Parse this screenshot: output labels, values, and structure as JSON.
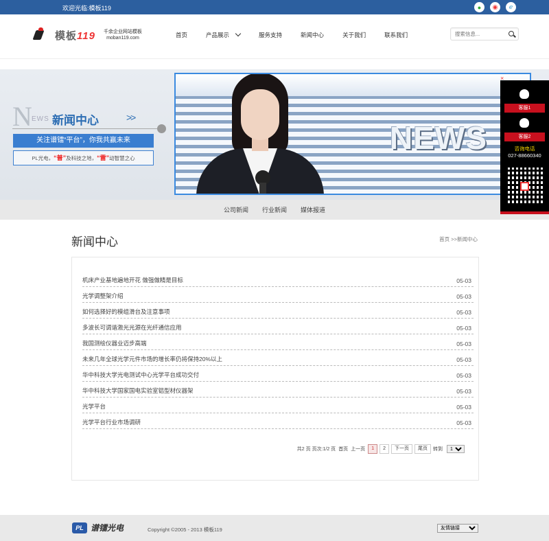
{
  "topbar": {
    "welcome": "欢迎光临:模板119"
  },
  "header": {
    "brand_cn": "模板",
    "brand_num": "119",
    "tagline_line1": "千余企业网站模板",
    "tagline_line2": "moban119.com",
    "nav": [
      {
        "label": "首页"
      },
      {
        "label": "产品展示"
      },
      {
        "label": "服务支持"
      },
      {
        "label": "新闻中心"
      },
      {
        "label": "关于我们"
      },
      {
        "label": "联系我们"
      }
    ],
    "search_placeholder": "搜索信息..."
  },
  "banner": {
    "big_letter": "N",
    "ews": "EWS",
    "title": "新闻中心",
    "arrows": ">>",
    "slogan": "关注谱镭“平台”，你我共赢未来",
    "line_prefix": "PL光电，",
    "word1": "“普”",
    "line_mid": "及科技之地，",
    "word2": "“雷”",
    "line_suffix": "动智慧之心",
    "photo_word": "NEWS"
  },
  "subnav": [
    "公司新闻",
    "行业新闻",
    "媒体报道"
  ],
  "page": {
    "title": "新闻中心",
    "breadcrumb": "首页 >>新闻中心"
  },
  "news": [
    {
      "title": "机床产业基地遍地开花 做强做精是目标",
      "date": "05-03"
    },
    {
      "title": "光学调整架介绍",
      "date": "05-03"
    },
    {
      "title": "如何选择好的模组滑台及注意事项",
      "date": "05-03"
    },
    {
      "title": "多波长可调谐激光光源在光纤通信应用",
      "date": "05-03"
    },
    {
      "title": "我国测绘仪器业迈步高端",
      "date": "05-03"
    },
    {
      "title": "未来几年全球光学元件市场的增长率仍将保持20%以上",
      "date": "05-03"
    },
    {
      "title": "华中科技大学光电测试中心光学平台成功交付",
      "date": "05-03"
    },
    {
      "title": "华中科技大学国家国电实验室铝型材仪器架",
      "date": "05-03"
    },
    {
      "title": "光学平台",
      "date": "05-03"
    },
    {
      "title": "光学平台行业市场调研",
      "date": "05-03"
    }
  ],
  "pager": {
    "summary": "共2 页 页次:1/2 页",
    "first": "首页",
    "prev": "上一页",
    "page1": "1",
    "page2": "2",
    "next": "下一页",
    "last": "尾页",
    "goto": "转到",
    "select_value": "1"
  },
  "float": {
    "close": "×",
    "kf1": "客服1",
    "kf2": "客服2",
    "hotline_label": "咨询电话",
    "hotline": "027-88660340"
  },
  "footer": {
    "logo_mark": "PL",
    "logo_name": "谱镭光电",
    "copyright": "Copyright ©2005 - 2013 模板119",
    "links_select": "友情链接"
  }
}
